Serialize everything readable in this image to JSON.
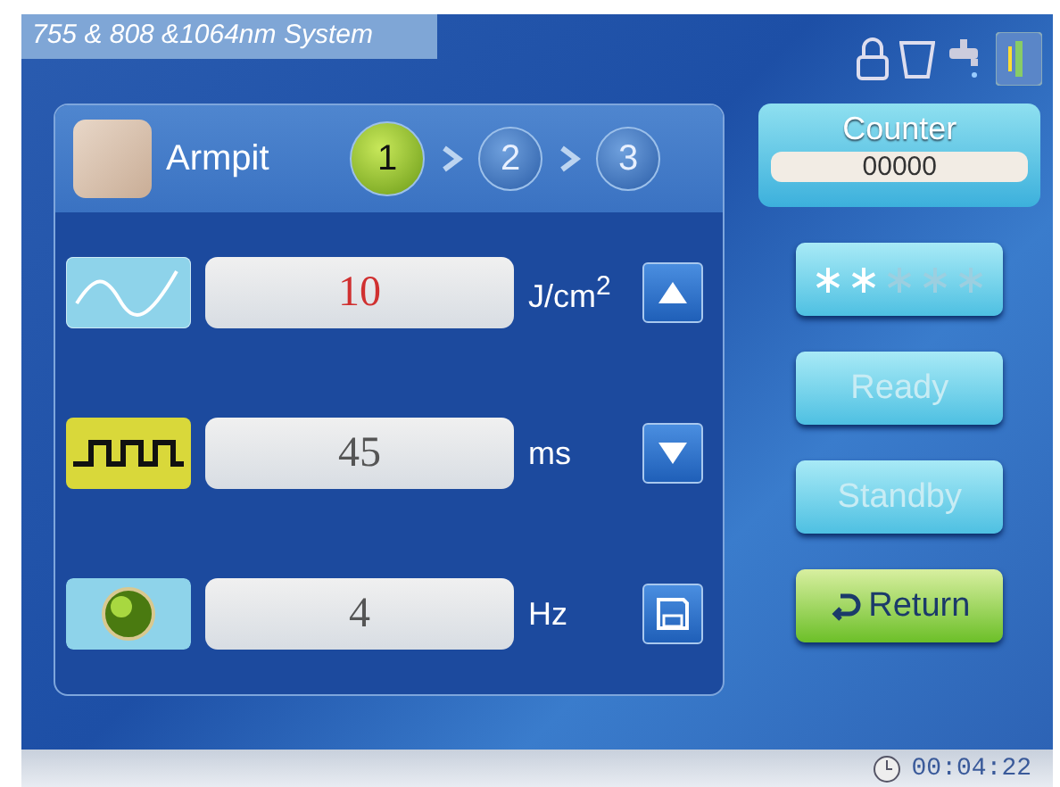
{
  "window": {
    "title": "755 & 808 &1064nm System"
  },
  "treatment": {
    "area": "Armpit",
    "steps": [
      {
        "label": "1",
        "selected": true
      },
      {
        "label": "2",
        "selected": false
      },
      {
        "label": "3",
        "selected": false
      }
    ]
  },
  "params": [
    {
      "kind": "fluence",
      "value": "10",
      "unit": "J/cm$^{2}$",
      "active": true,
      "control": {
        "kind": "up"
      }
    },
    {
      "kind": "pulse",
      "value": "45",
      "unit": "ms",
      "active": false,
      "control": {
        "kind": "down"
      }
    },
    {
      "kind": "frequency",
      "value": "4",
      "unit": "Hz",
      "active": false,
      "control": {
        "kind": "save"
      }
    }
  ],
  "counter": {
    "label": "Counter",
    "value": "00000"
  },
  "cooling": {
    "stars": 2
  },
  "buttons": [
    {
      "kind": "plain",
      "label": "Ready",
      "disabled": true
    },
    {
      "kind": "plain",
      "label": "Standby",
      "disabled": true
    },
    {
      "kind": "return",
      "label": "Return"
    }
  ],
  "status_bar": {
    "time": "00:04:22"
  }
}
